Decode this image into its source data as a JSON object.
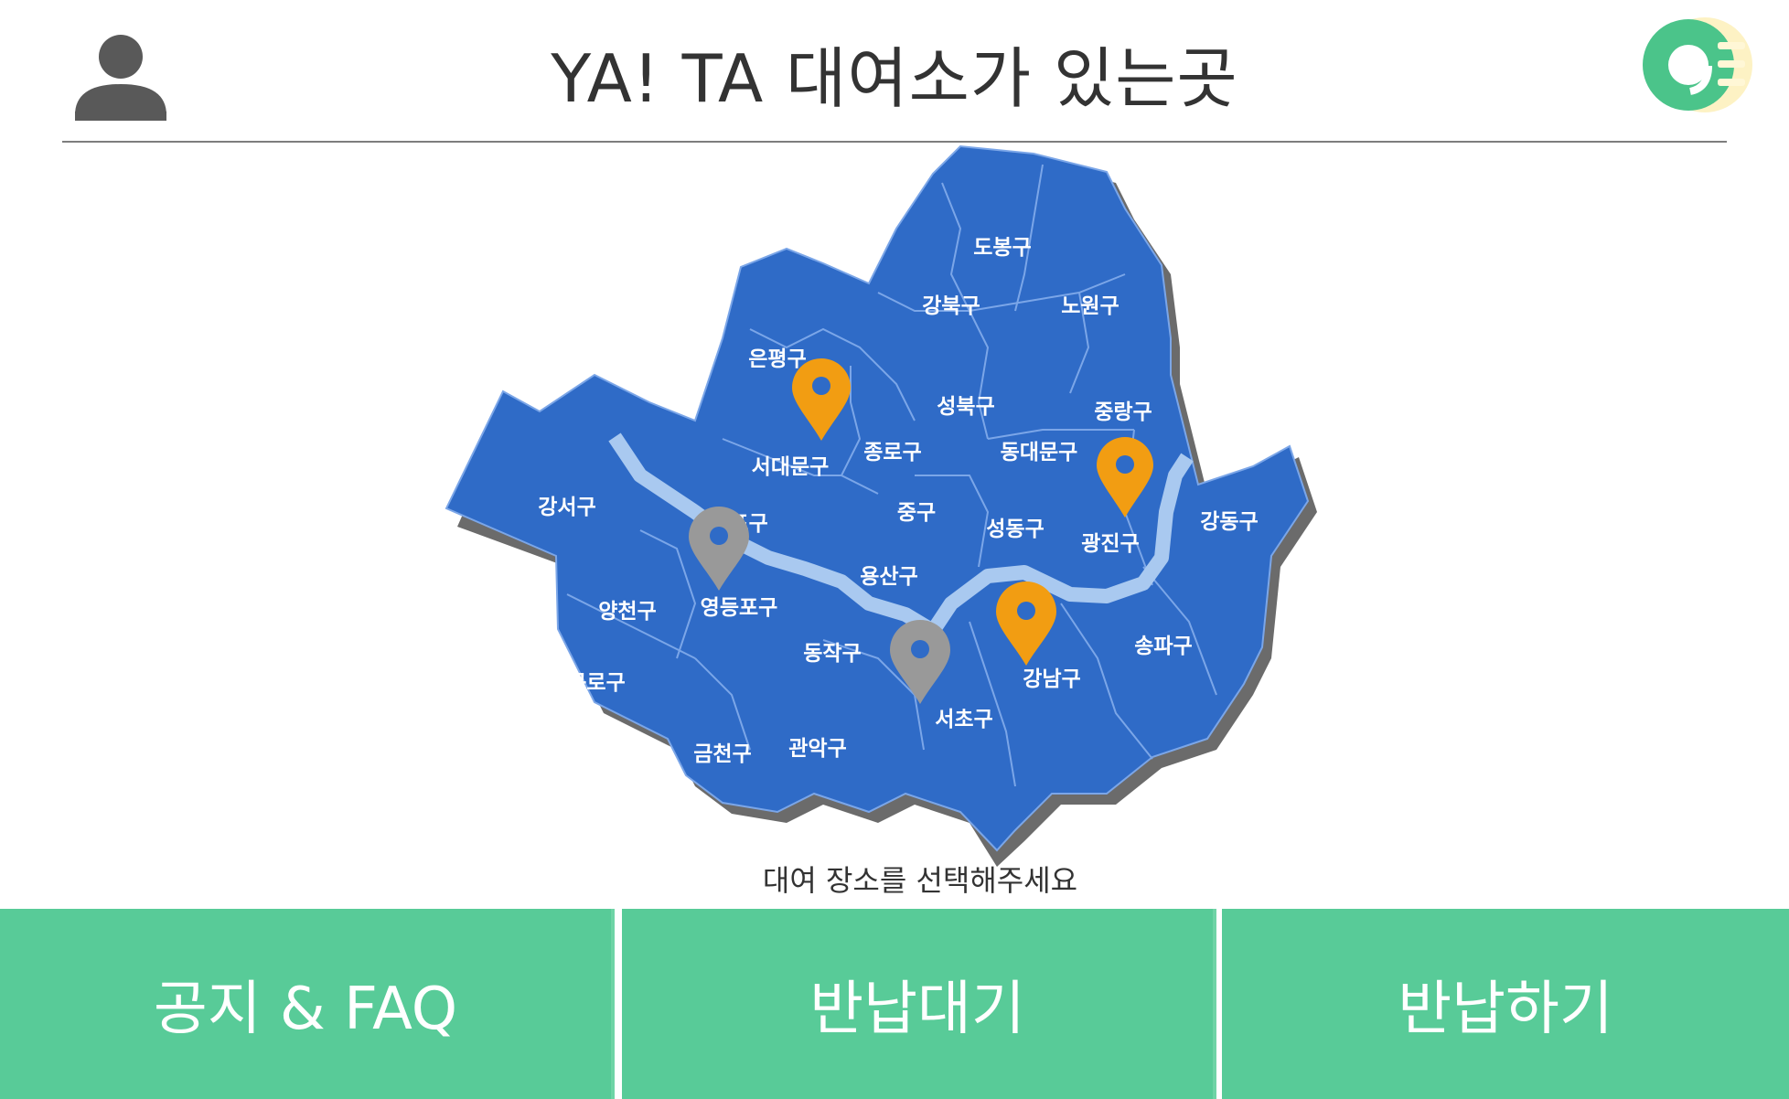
{
  "header": {
    "title": "YA! TA 대여소가 있는곳",
    "profile_icon": "user-icon",
    "menu_icon": "menu-logo-icon"
  },
  "map": {
    "region_icon": "seoul-map",
    "colors": {
      "district": "#2f6bc7",
      "border": "#7ba6e8",
      "shadow": "#666666",
      "river": "#a9c9f0",
      "pin_available": "#f29d12",
      "pin_unavailable": "#999999"
    },
    "districts": [
      {
        "name": "도봉구"
      },
      {
        "name": "강북구"
      },
      {
        "name": "노원구"
      },
      {
        "name": "은평구"
      },
      {
        "name": "성북구"
      },
      {
        "name": "중랑구"
      },
      {
        "name": "종로구"
      },
      {
        "name": "동대문구"
      },
      {
        "name": "서대문구"
      },
      {
        "name": "강서구"
      },
      {
        "name": "마포구"
      },
      {
        "name": "중구"
      },
      {
        "name": "성동구"
      },
      {
        "name": "광진구"
      },
      {
        "name": "강동구"
      },
      {
        "name": "용산구"
      },
      {
        "name": "양천구"
      },
      {
        "name": "영등포구"
      },
      {
        "name": "동작구"
      },
      {
        "name": "송파구"
      },
      {
        "name": "강남구"
      },
      {
        "name": "구로구"
      },
      {
        "name": "서초구"
      },
      {
        "name": "금천구"
      },
      {
        "name": "관악구"
      }
    ],
    "pins": [
      {
        "district": "서대문구",
        "status": "available"
      },
      {
        "district": "광진구",
        "status": "available"
      },
      {
        "district": "강남구",
        "status": "available"
      },
      {
        "district": "영등포구",
        "status": "unavailable"
      },
      {
        "district": "서초구",
        "status": "unavailable"
      }
    ]
  },
  "hint": "대여 장소를 선택해주세요",
  "tabs": [
    {
      "label": "공지 & FAQ"
    },
    {
      "label": "반납대기"
    },
    {
      "label": "반납하기"
    }
  ]
}
